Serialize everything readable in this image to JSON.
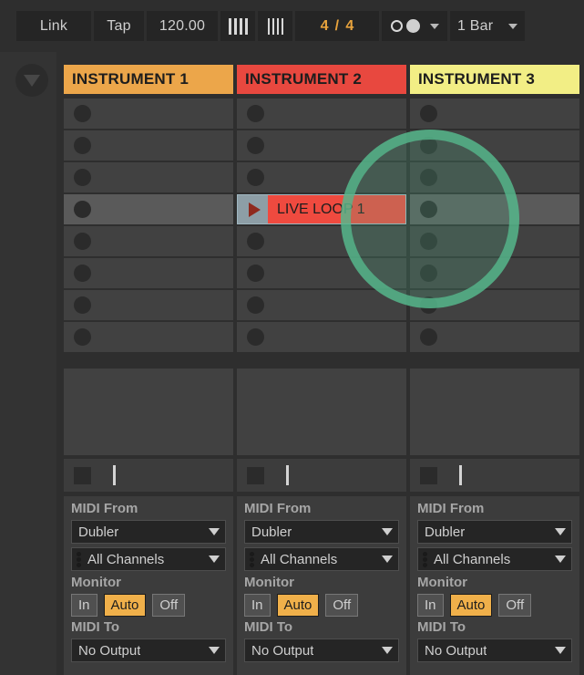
{
  "toolbar": {
    "link_label": "Link",
    "tap_label": "Tap",
    "tempo_value": "120.00",
    "grid_coarse_icon": "grid-bars-thick-icon",
    "grid_fine_icon": "grid-bars-thin-icon",
    "time_signature_numerator": "4",
    "time_signature_separator": "/",
    "time_signature_denominator": "4",
    "quantize_icon": "metronome-circles-icon",
    "quantize_dropdown_icon": "chevron-down-icon",
    "launch_quantization": "1 Bar",
    "launch_quantization_dropdown_icon": "chevron-down-icon"
  },
  "sidebar": {
    "collapse_icon": "triangle-down-icon"
  },
  "session": {
    "scene_rows": 8,
    "selected_row_index": 3,
    "tracks": [
      {
        "name": "INSTRUMENT 1",
        "color": "#eda martial",
        "header_color": "#eca64a",
        "stop_icon": "stop-square-icon",
        "slots": [
          {
            "type": "empty",
            "icon": "record-dot-icon"
          },
          {
            "type": "empty",
            "icon": "record-dot-icon"
          },
          {
            "type": "empty",
            "icon": "record-dot-icon"
          },
          {
            "type": "empty",
            "icon": "record-dot-icon"
          },
          {
            "type": "empty",
            "icon": "record-dot-icon"
          },
          {
            "type": "empty",
            "icon": "record-dot-icon"
          },
          {
            "type": "empty",
            "icon": "record-dot-icon"
          },
          {
            "type": "empty",
            "icon": "record-dot-icon"
          }
        ],
        "io": {
          "midi_from_label": "MIDI From",
          "midi_from_value": "Dubler",
          "midi_channel_value": "All Channels",
          "midi_channel_icon": "three-dots-icon",
          "monitor_label": "Monitor",
          "monitor_options": [
            "In",
            "Auto",
            "Off"
          ],
          "monitor_active": "Auto",
          "midi_to_label": "MIDI To",
          "midi_to_value": "No Output"
        }
      },
      {
        "name": "INSTRUMENT 2",
        "header_color": "#e8483f",
        "stop_icon": "stop-square-icon",
        "slots": [
          {
            "type": "empty",
            "icon": "record-dot-icon"
          },
          {
            "type": "empty",
            "icon": "record-dot-icon"
          },
          {
            "type": "empty",
            "icon": "record-dot-icon"
          },
          {
            "type": "clip",
            "name": "LIVE LOOP 1",
            "color": "#ef4a3f",
            "launch_icon": "play-triangle-icon"
          },
          {
            "type": "empty",
            "icon": "record-dot-icon"
          },
          {
            "type": "empty",
            "icon": "record-dot-icon"
          },
          {
            "type": "empty",
            "icon": "record-dot-icon"
          },
          {
            "type": "empty",
            "icon": "record-dot-icon"
          }
        ],
        "io": {
          "midi_from_label": "MIDI From",
          "midi_from_value": "Dubler",
          "midi_channel_value": "All Channels",
          "midi_channel_icon": "three-dots-icon",
          "monitor_label": "Monitor",
          "monitor_options": [
            "In",
            "Auto",
            "Off"
          ],
          "monitor_active": "Auto",
          "midi_to_label": "MIDI To",
          "midi_to_value": "No Output"
        }
      },
      {
        "name": "INSTRUMENT 3",
        "header_color": "#f2ee85",
        "stop_icon": "stop-square-icon",
        "slots": [
          {
            "type": "empty",
            "icon": "record-dot-icon"
          },
          {
            "type": "empty",
            "icon": "record-dot-icon"
          },
          {
            "type": "empty",
            "icon": "record-dot-icon"
          },
          {
            "type": "empty",
            "icon": "record-dot-icon"
          },
          {
            "type": "empty",
            "icon": "record-dot-icon"
          },
          {
            "type": "empty",
            "icon": "record-dot-icon"
          },
          {
            "type": "empty",
            "icon": "record-dot-icon"
          },
          {
            "type": "empty",
            "icon": "record-dot-icon"
          }
        ],
        "io": {
          "midi_from_label": "MIDI From",
          "midi_from_value": "Dubler",
          "midi_channel_value": "All Channels",
          "midi_channel_icon": "three-dots-icon",
          "monitor_label": "Monitor",
          "monitor_options": [
            "In",
            "Auto",
            "Off"
          ],
          "monitor_active": "Auto",
          "midi_to_label": "MIDI To",
          "midi_to_value": "No Output"
        }
      }
    ]
  },
  "overlay": {
    "focus_ring_color": "#56b88c"
  }
}
